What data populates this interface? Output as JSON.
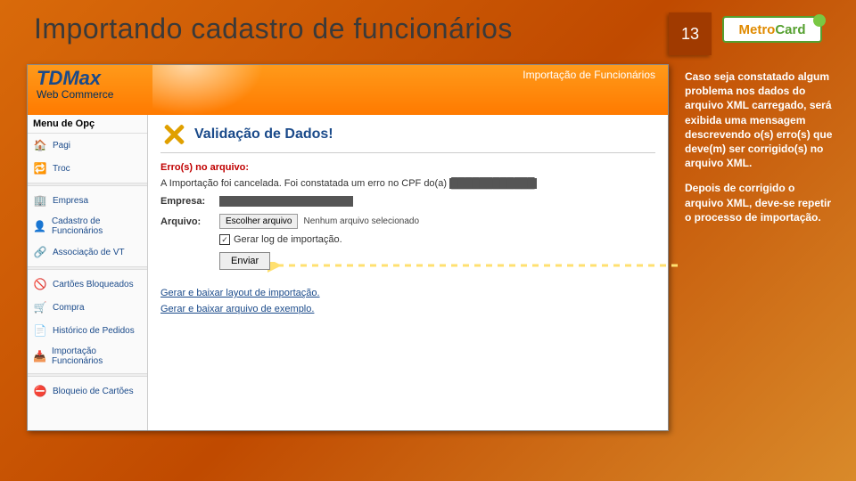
{
  "title": "Importando cadastro de funcionários",
  "page_number": "13",
  "logo": {
    "part1": "Metro",
    "part2": "Card"
  },
  "app": {
    "product": "TDMax",
    "product_sub": "Web Commerce",
    "crumb": "Importação de Funcionários",
    "menu_title": "Menu de Opç",
    "menu": [
      {
        "label": "Pagi",
        "icon": "🏠"
      },
      {
        "label": "Troc",
        "icon": "🔁"
      },
      {
        "label": "Empresa",
        "icon": "🏢"
      },
      {
        "label": "Cadastro de Funcionários",
        "icon": "👤"
      },
      {
        "label": "Associação de VT",
        "icon": "🔗"
      },
      {
        "label": "Cartões Bloqueados",
        "icon": "🚫"
      },
      {
        "label": "Compra",
        "icon": "🛒"
      },
      {
        "label": "Histórico de Pedidos",
        "icon": "📄"
      },
      {
        "label": "Importação Funcionários",
        "icon": "📥"
      },
      {
        "label": "Bloqueio de Cartões",
        "icon": "⛔"
      }
    ],
    "panel_title": "Validação de Dados!",
    "error_label": "Erro(s) no arquivo:",
    "error_msg_prefix": "A Importação foi cancelada. Foi constatada um erro no CPF do(a)",
    "empresa_label": "Empresa:",
    "arquivo_label": "Arquivo:",
    "file_button": "Escolher arquivo",
    "file_status": "Nenhum arquivo selecionado",
    "checkbox_label": "Gerar log de importação.",
    "submit_label": "Enviar",
    "link1": "Gerar e baixar layout de importação.",
    "link2": "Gerar e baixar arquivo de exemplo."
  },
  "side": {
    "p1": "Caso seja constatado algum problema nos dados do arquivo XML carregado, será exibida uma mensagem descrevendo o(s) erro(s) que deve(m) ser corrigido(s) no arquivo XML.",
    "p2": "Depois de corrigido o arquivo XML, deve-se repetir o processo de importação."
  }
}
